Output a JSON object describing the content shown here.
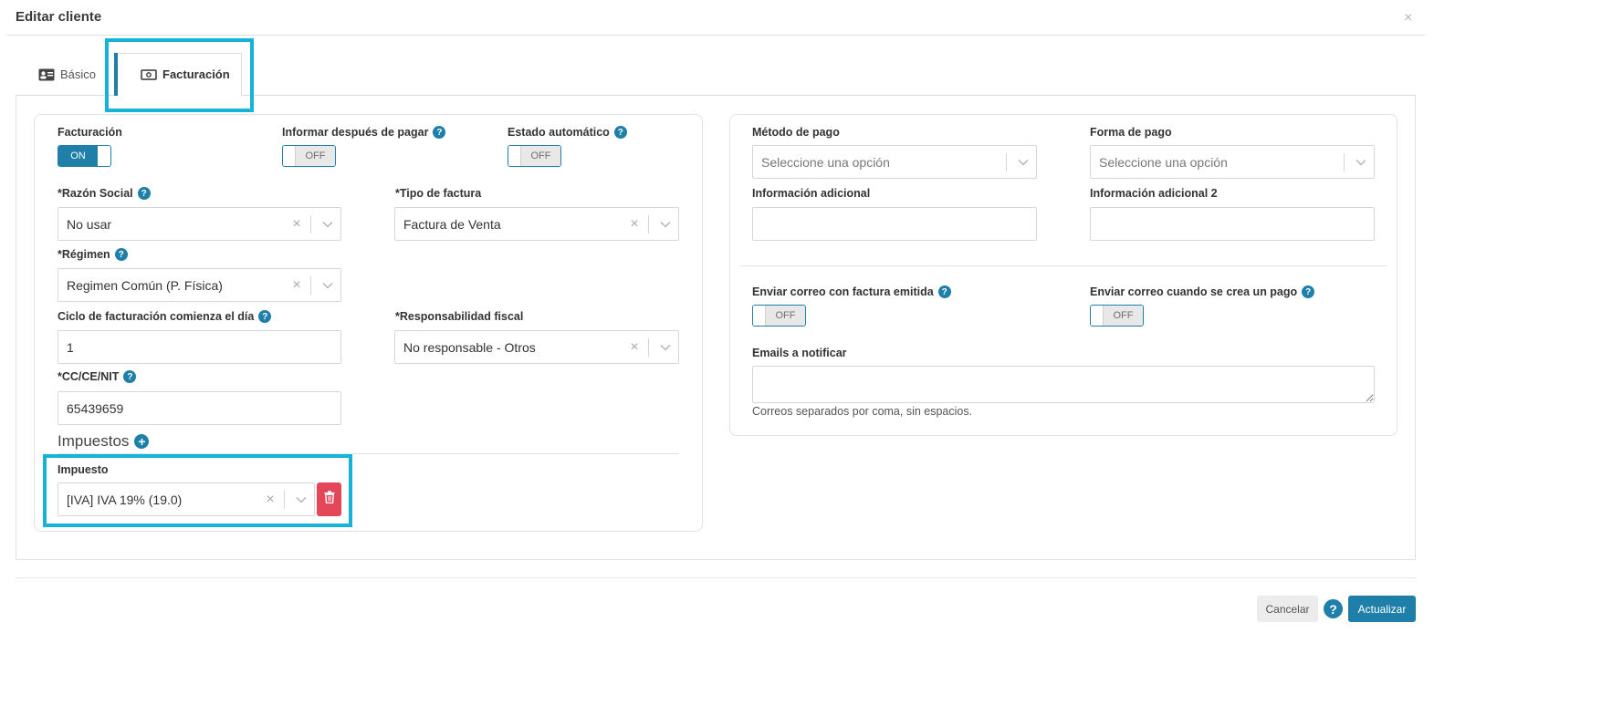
{
  "modal": {
    "title": "Editar cliente",
    "close": "×"
  },
  "tabs": [
    {
      "label": "Básico",
      "icon": "id-card-icon"
    },
    {
      "label": "Facturación",
      "icon": "money-bill-icon"
    }
  ],
  "left": {
    "facturacion": {
      "label": "Facturación",
      "toggle": "ON"
    },
    "informar": {
      "label": "Informar después de pagar",
      "toggle": "OFF"
    },
    "estado": {
      "label": "Estado automático",
      "toggle": "OFF"
    },
    "razon_social": {
      "label": "*Razón Social",
      "value": "No usar"
    },
    "tipo_factura": {
      "label": "*Tipo de factura",
      "value": "Factura de Venta"
    },
    "regimen": {
      "label": "*Régimen",
      "value": "Regimen Común (P. Física)"
    },
    "ciclo": {
      "label": "Ciclo de facturación comienza el día",
      "value": "1"
    },
    "responsabilidad": {
      "label": "*Responsabilidad fiscal",
      "value": "No responsable - Otros"
    },
    "cc": {
      "label": "*CC/CE/NIT",
      "value": "65439659"
    },
    "impuestos": {
      "title": "Impuestos"
    },
    "impuesto": {
      "label": "Impuesto",
      "value": "[IVA] IVA 19% (19.0)"
    }
  },
  "right": {
    "metodo_pago": {
      "label": "Método de pago",
      "placeholder": "Seleccione una opción"
    },
    "forma_pago": {
      "label": "Forma de pago",
      "placeholder": "Seleccione una opción"
    },
    "info_adicional": {
      "label": "Información adicional",
      "value": ""
    },
    "info_adicional2": {
      "label": "Información adicional 2",
      "value": ""
    },
    "correo_factura": {
      "label": "Enviar correo con factura emitida",
      "toggle": "OFF"
    },
    "correo_pago": {
      "label": "Enviar correo cuando se crea un pago",
      "toggle": "OFF"
    },
    "emails": {
      "label": "Emails a notificar",
      "value": "",
      "hint": "Correos separados por coma, sin espacios."
    }
  },
  "footer": {
    "cancel": "Cancelar",
    "update": "Actualizar",
    "help": "?"
  },
  "colors": {
    "accent": "#1e7fa8",
    "highlight": "#16b3d9",
    "danger": "#e4475a"
  }
}
